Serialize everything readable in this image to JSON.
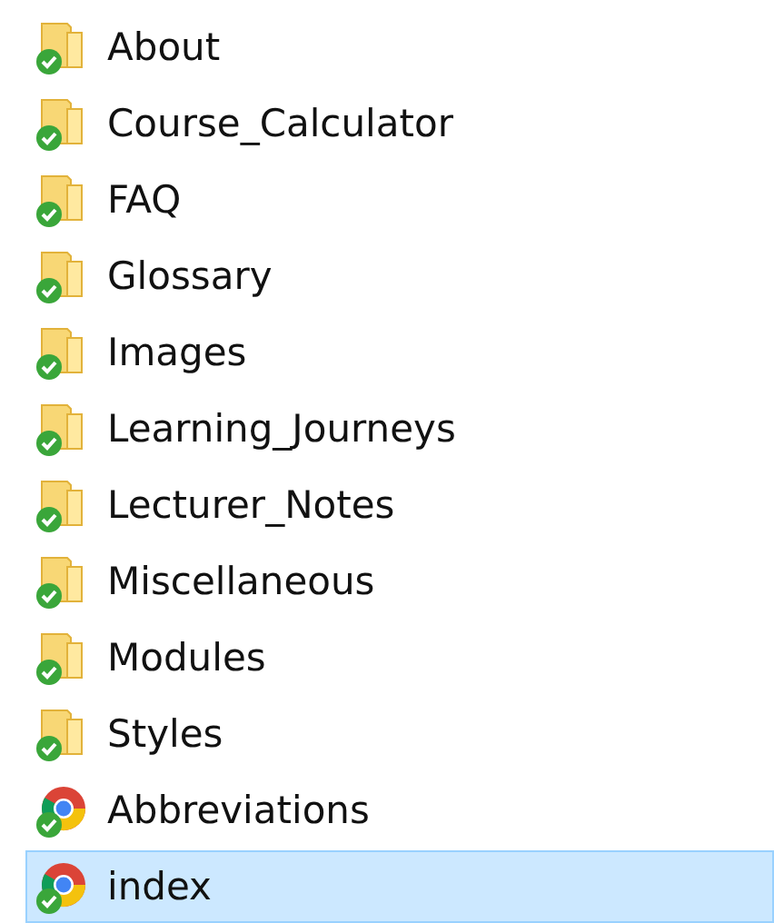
{
  "items": [
    {
      "name": "About",
      "kind": "folder",
      "synced": true,
      "selected": false
    },
    {
      "name": "Course_Calculator",
      "kind": "folder",
      "synced": true,
      "selected": false
    },
    {
      "name": "FAQ",
      "kind": "folder",
      "synced": true,
      "selected": false
    },
    {
      "name": "Glossary",
      "kind": "folder",
      "synced": true,
      "selected": false
    },
    {
      "name": "Images",
      "kind": "folder",
      "synced": true,
      "selected": false
    },
    {
      "name": "Learning_Journeys",
      "kind": "folder",
      "synced": true,
      "selected": false
    },
    {
      "name": "Lecturer_Notes",
      "kind": "folder",
      "synced": true,
      "selected": false
    },
    {
      "name": "Miscellaneous",
      "kind": "folder",
      "synced": true,
      "selected": false
    },
    {
      "name": "Modules",
      "kind": "folder",
      "synced": true,
      "selected": false
    },
    {
      "name": "Styles",
      "kind": "folder",
      "synced": true,
      "selected": false
    },
    {
      "name": "Abbreviations",
      "kind": "browser-file",
      "synced": true,
      "selected": false
    },
    {
      "name": "index",
      "kind": "browser-file",
      "synced": true,
      "selected": true
    }
  ]
}
